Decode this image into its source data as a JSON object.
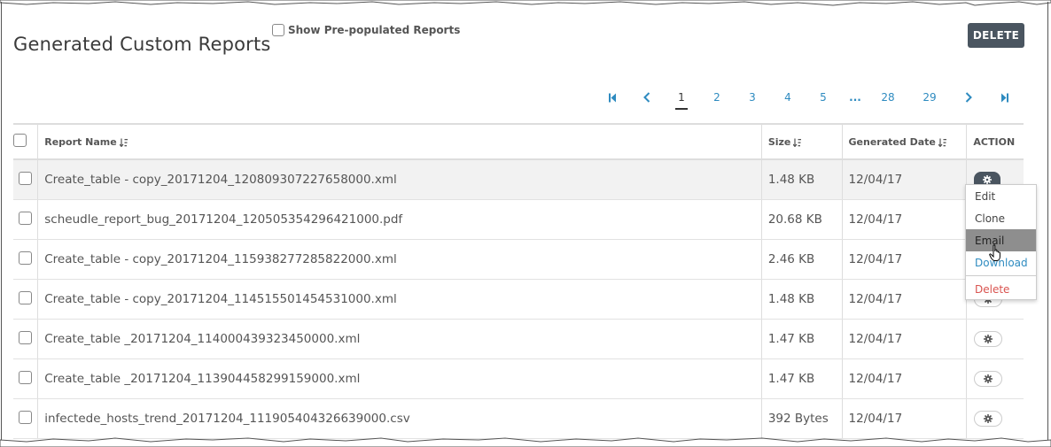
{
  "page": {
    "title": "Generated Custom Reports",
    "show_prepopulated_label": "Show Pre-populated Reports",
    "delete_label": "DELETE"
  },
  "pagination": {
    "pages": [
      "1",
      "2",
      "3",
      "4",
      "5",
      "...",
      "28",
      "29"
    ],
    "active_page": "1"
  },
  "table": {
    "columns": {
      "name": "Report Name",
      "size": "Size",
      "date": "Generated Date",
      "action": "ACTION"
    },
    "rows": [
      {
        "name": "Create_table - copy_20171204_120809307227658000.xml",
        "size": "1.48 KB",
        "date": "12/04/17"
      },
      {
        "name": "scheudle_report_bug_20171204_120505354296421000.pdf",
        "size": "20.68 KB",
        "date": "12/04/17"
      },
      {
        "name": "Create_table - copy_20171204_115938277285822000.xml",
        "size": "2.46 KB",
        "date": "12/04/17"
      },
      {
        "name": "Create_table - copy_20171204_114515501454531000.xml",
        "size": "1.48 KB",
        "date": "12/04/17"
      },
      {
        "name": "Create_table _20171204_114000439323450000.xml",
        "size": "1.47 KB",
        "date": "12/04/17"
      },
      {
        "name": "Create_table _20171204_113904458299159000.xml",
        "size": "1.47 KB",
        "date": "12/04/17"
      },
      {
        "name": "infectede_hosts_trend_20171204_111905404326639000.csv",
        "size": "392 Bytes",
        "date": "12/04/17"
      }
    ]
  },
  "action_menu": {
    "items": [
      "Edit",
      "Clone",
      "Email",
      "Download",
      "Delete"
    ],
    "hovered": "Email"
  },
  "colors": {
    "link": "#2e8bc0",
    "danger": "#d9534f",
    "button_bg": "#4a5560"
  },
  "icons": {
    "sort": "sort-icon",
    "gear": "gear-icon",
    "first": "first-page-icon",
    "prev": "prev-page-icon",
    "next": "next-page-icon",
    "last": "last-page-icon",
    "cursor": "hand-cursor-icon"
  }
}
